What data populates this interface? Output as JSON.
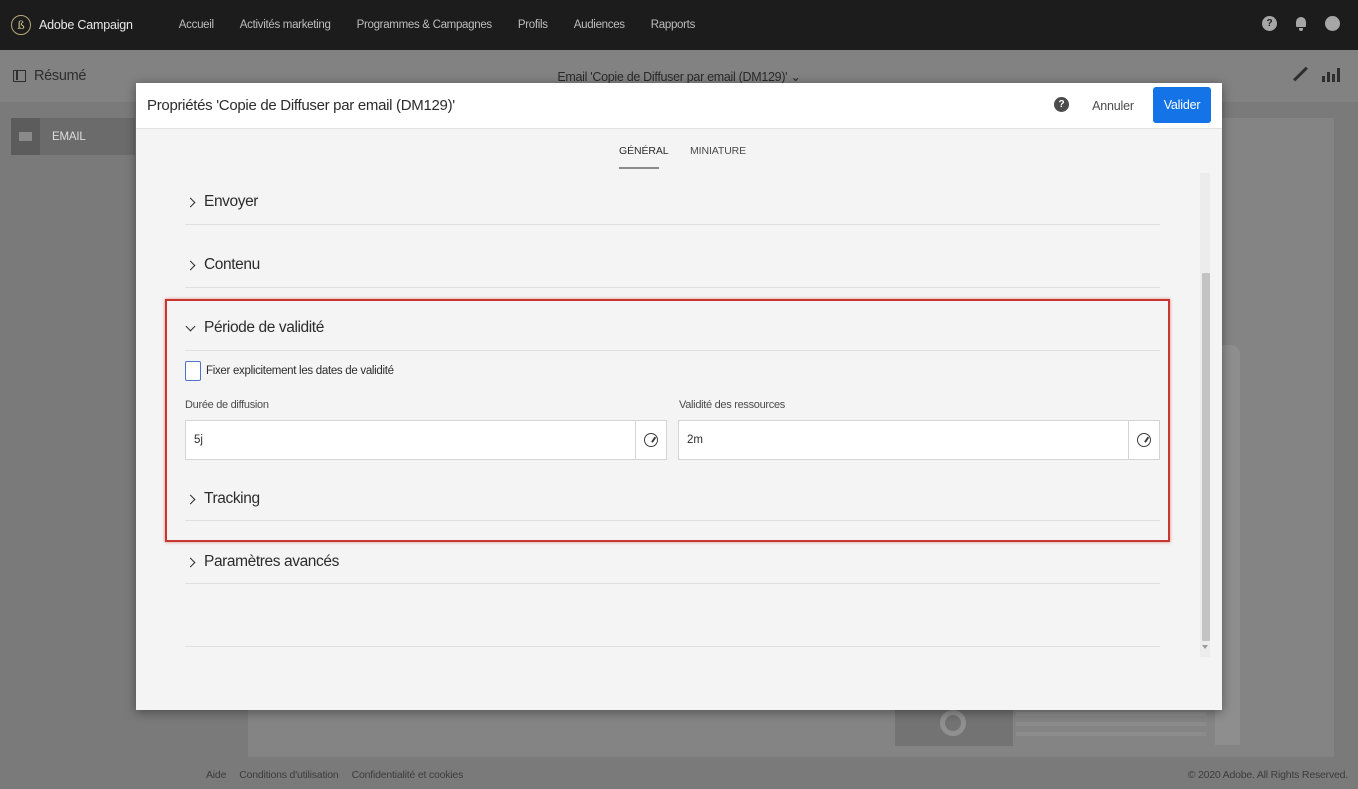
{
  "app": {
    "name": "Adobe Campaign",
    "nav": [
      "Accueil",
      "Activités marketing",
      "Programmes & Campagnes",
      "Profils",
      "Audiences",
      "Rapports"
    ],
    "help_glyph": "?"
  },
  "page": {
    "summary_label": "Résumé",
    "title": "Email 'Copie de Diffuser par email (DM129)'",
    "title_chevron": "⌄",
    "side_item_label": "EMAIL"
  },
  "modal": {
    "title": "Propriétés 'Copie de Diffuser par email (DM129)'",
    "help_glyph": "?",
    "cancel_label": "Annuler",
    "validate_label": "Valider",
    "tabs": [
      {
        "label": "GÉNÉRAL",
        "active": true
      },
      {
        "label": "MINIATURE",
        "active": false
      }
    ],
    "sections": {
      "send": "Envoyer",
      "content": "Contenu",
      "validity": "Période de validité",
      "tracking": "Tracking",
      "advanced": "Paramètres avancés"
    },
    "validity": {
      "checkbox_label": "Fixer explicitement les dates de validité",
      "checkbox_checked": false,
      "duration_label": "Durée de diffusion",
      "duration_value": "5j",
      "resources_label": "Validité des ressources",
      "resources_value": "2m"
    }
  },
  "footer": {
    "links": [
      "Aide",
      "Conditions d'utilisation",
      "Confidentialité et cookies"
    ],
    "copyright": "© 2020 Adobe. All Rights Reserved."
  },
  "colors": {
    "accent": "#1473e6",
    "highlight": "#c8372f",
    "checkbox_border": "#4d73c8"
  }
}
